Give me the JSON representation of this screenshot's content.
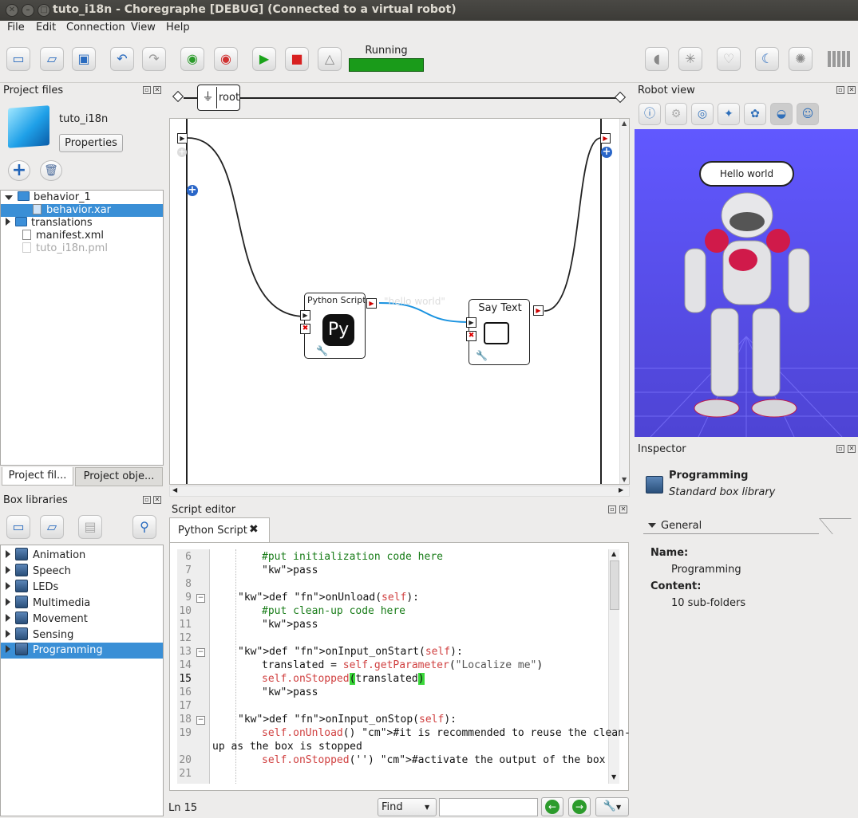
{
  "window": {
    "title": "tuto_i18n - Choregraphe [DEBUG] (Connected to a virtual robot)"
  },
  "menu": [
    "File",
    "Edit",
    "Connection",
    "View",
    "Help"
  ],
  "toolbar": {
    "status_label": "Running"
  },
  "project_files": {
    "title": "Project files",
    "project_name": "tuto_i18n",
    "properties_label": "Properties",
    "tree": [
      {
        "label": "behavior_1",
        "type": "folder",
        "expanded": true
      },
      {
        "label": "behavior.xar",
        "type": "file",
        "selected": true
      },
      {
        "label": "translations",
        "type": "folder",
        "expanded": false
      },
      {
        "label": "manifest.xml",
        "type": "file"
      },
      {
        "label": "tuto_i18n.pml",
        "type": "file",
        "disabled": true
      }
    ],
    "tabs": [
      "Project fil...",
      "Project obje..."
    ]
  },
  "box_libraries": {
    "title": "Box libraries",
    "items": [
      "Animation",
      "Speech",
      "LEDs",
      "Multimedia",
      "Movement",
      "Sensing",
      "Programming"
    ],
    "selected": "Programming"
  },
  "flow": {
    "breadcrumb": "root",
    "boxes": {
      "python_script": "Python Script",
      "say_text": "Say Text"
    },
    "link_label": "\"hello world\""
  },
  "script_editor": {
    "title": "Script editor",
    "tab_label": "Python Script",
    "status_line": "Ln 15",
    "find_label": "Find",
    "lines": [
      {
        "n": "6",
        "text": "#put initialization code here"
      },
      {
        "n": "7",
        "text": "pass"
      },
      {
        "n": "8",
        "text": ""
      },
      {
        "n": "9",
        "text": "def onUnload(self):"
      },
      {
        "n": "10",
        "text": "#put clean-up code here"
      },
      {
        "n": "11",
        "text": "pass"
      },
      {
        "n": "12",
        "text": ""
      },
      {
        "n": "13",
        "text": "def onInput_onStart(self):"
      },
      {
        "n": "14",
        "text": "translated = self.getParameter(\"Localize me\")"
      },
      {
        "n": "15",
        "text": "self.onStopped(translated)"
      },
      {
        "n": "16",
        "text": "pass"
      },
      {
        "n": "17",
        "text": ""
      },
      {
        "n": "18",
        "text": "def onInput_onStop(self):"
      },
      {
        "n": "19",
        "text": "self.onUnload() #it is recommended to reuse the clean-"
      },
      {
        "n": "",
        "text": "up as the box is stopped"
      },
      {
        "n": "20",
        "text": "self.onStopped('') #activate the output of the box"
      },
      {
        "n": "21",
        "text": ""
      }
    ]
  },
  "robot_view": {
    "title": "Robot view",
    "speech_bubble": "Hello world"
  },
  "inspector": {
    "title": "Inspector",
    "heading": "Programming",
    "subheading": "Standard box library",
    "section": "General",
    "name_label": "Name:",
    "name_value": "Programming",
    "content_label": "Content:",
    "content_value": "10 sub-folders"
  },
  "colors": {
    "accent": "#3a8fd6",
    "running": "#1a9b1a",
    "robot_bg": "#5a4fe0"
  }
}
